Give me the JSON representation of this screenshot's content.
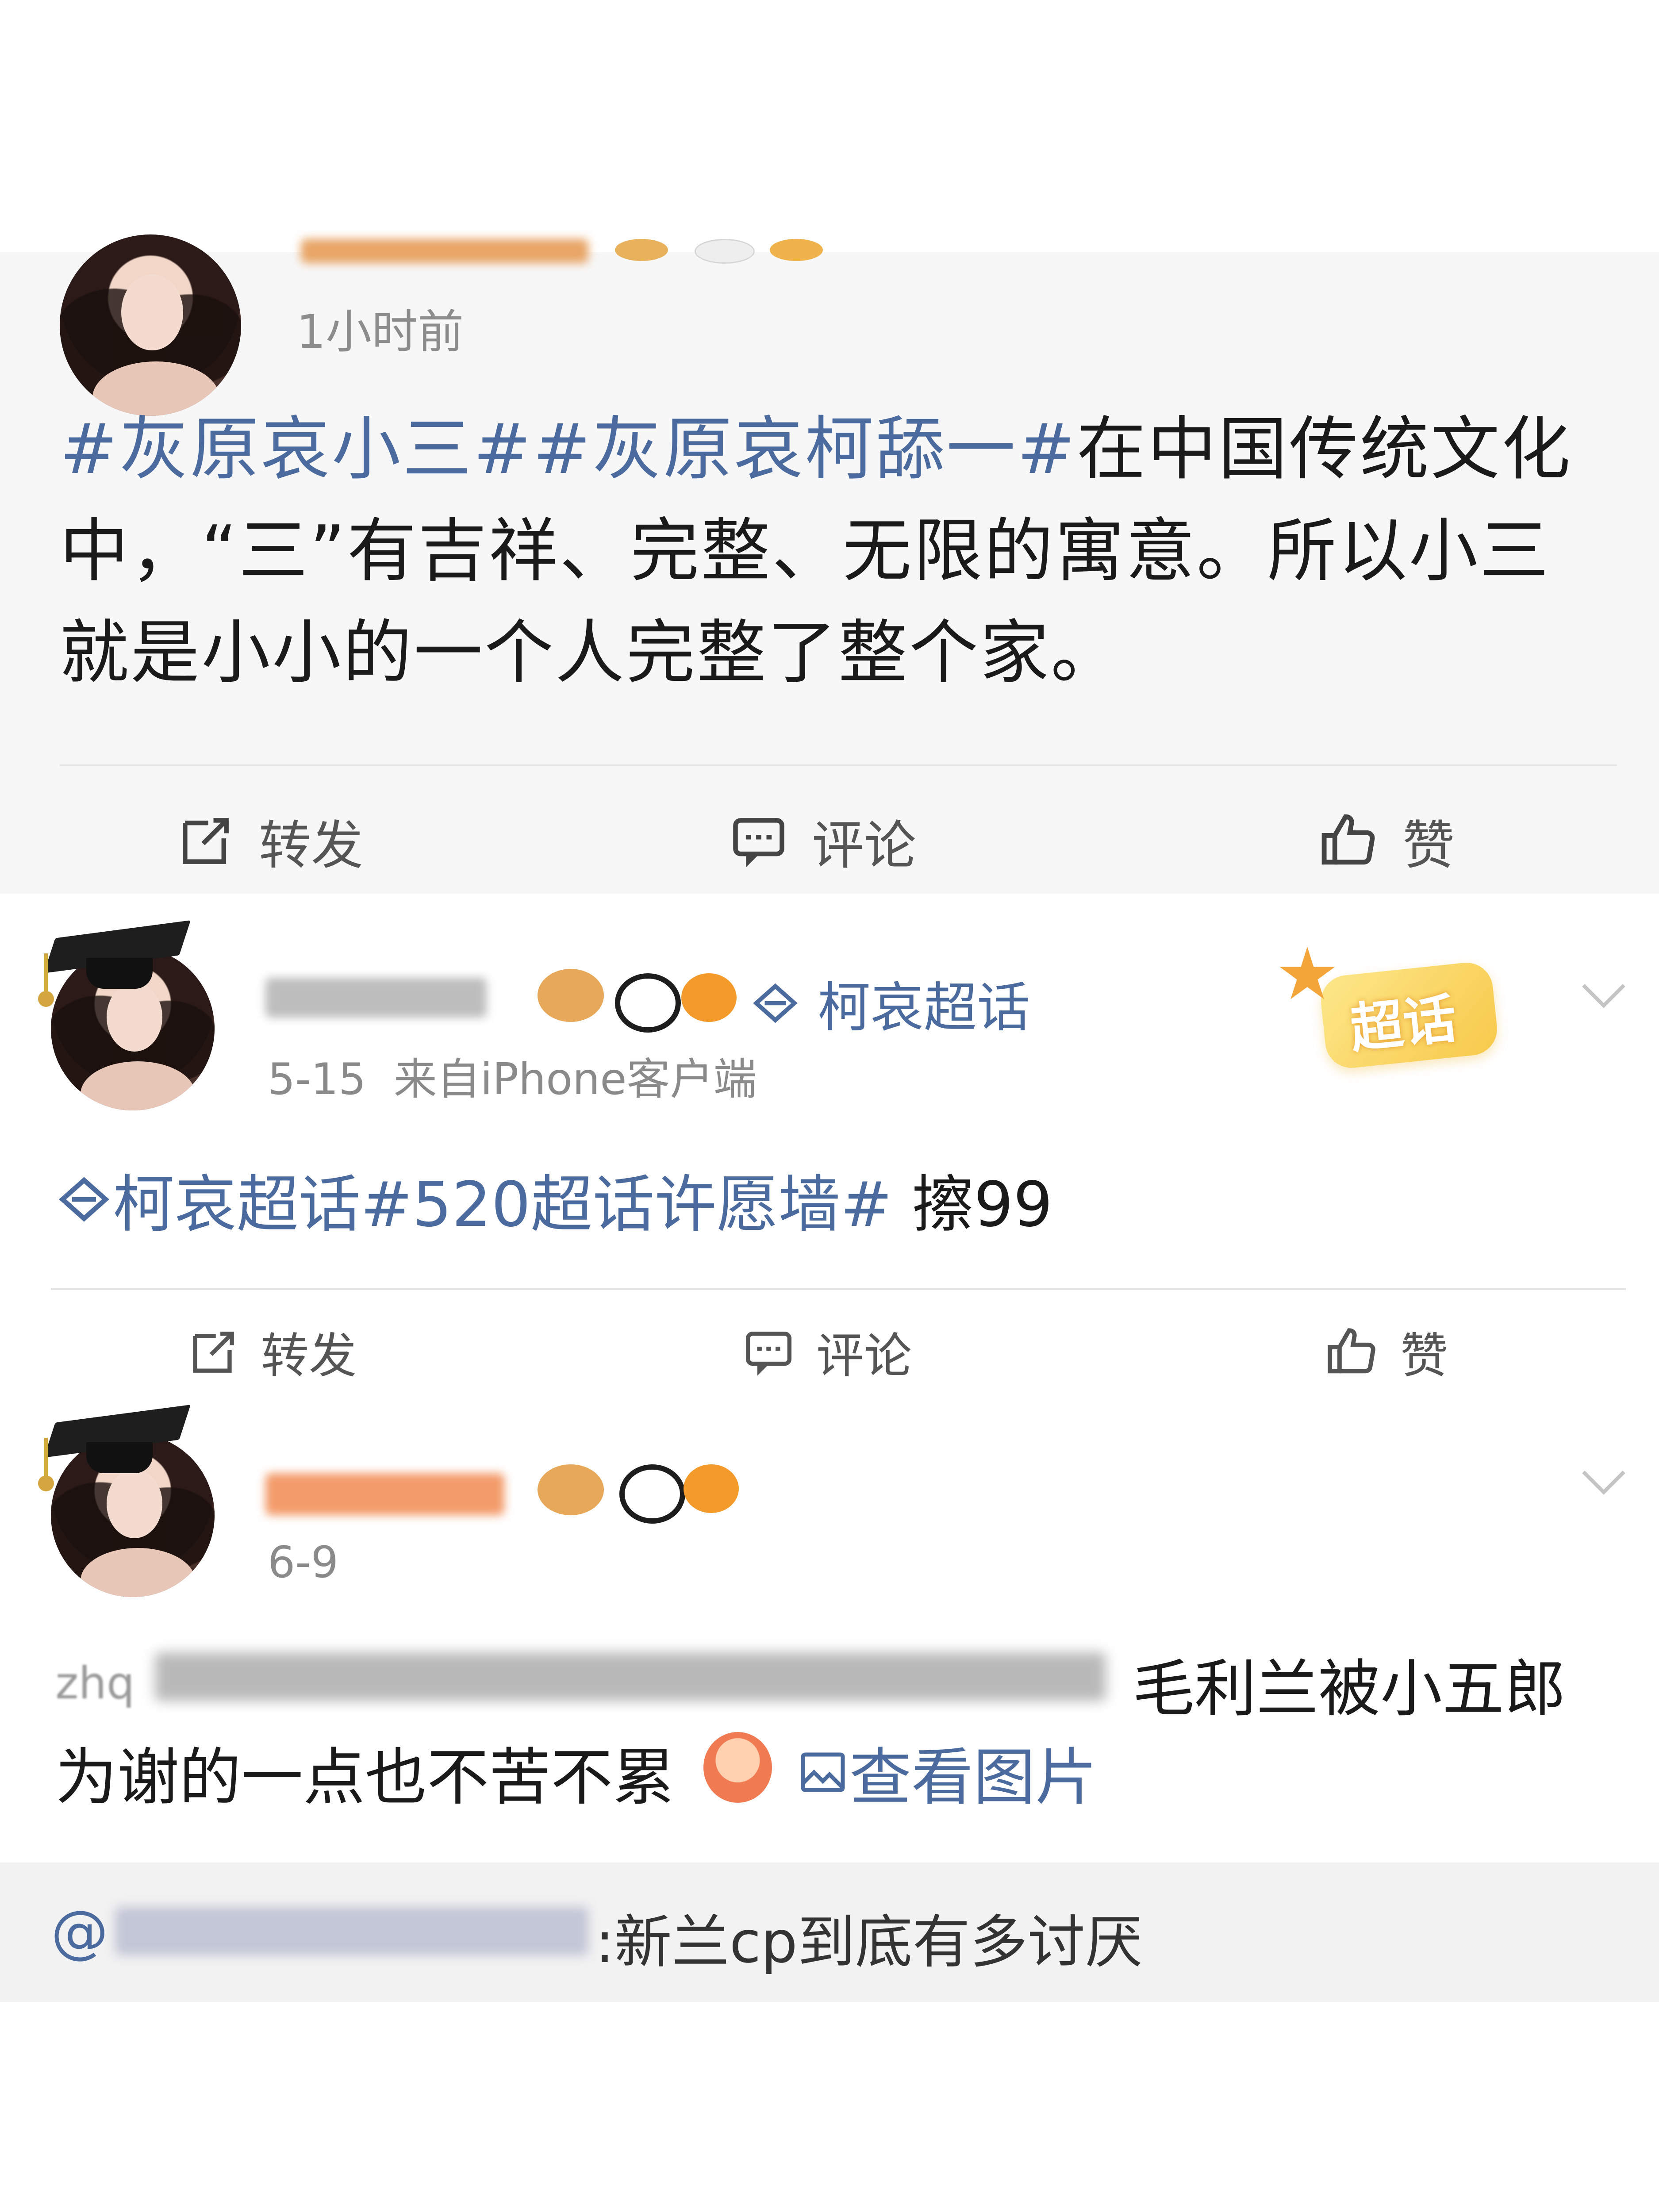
{
  "posts": [
    {
      "time": "1小时前",
      "text_link": "#灰原哀小三##灰原哀柯舔一#",
      "text_line1_rest": "在中国传统文化",
      "text_line2": "中，“三”有吉祥、完整、无限的寓意。所以小三",
      "text_line3": "就是小小的一个人完整了整个家。",
      "actions": {
        "repost": "转发",
        "comment": "评论",
        "like": "赞"
      }
    },
    {
      "topic_link": "柯哀超话",
      "meta": "5-15  来自iPhone客户端",
      "badge": "超话",
      "text_link": "柯哀超话#520超话许愿墙#",
      "text_rest": " 擦99",
      "actions": {
        "repost": "转发",
        "comment": "评论",
        "like": "赞"
      }
    },
    {
      "meta": "6-9",
      "text_line1_prefix": "zhq",
      "text_line1_rest": "毛利兰被小五郎",
      "text_line2": "为谢的一点也不苦不累",
      "view_image": "查看图片",
      "quote_prefix": "@",
      "quote_text": ":新兰cp到底有多讨厌"
    }
  ],
  "icons": {
    "repost": "edit-square-icon",
    "comment": "comment-bubble-icon",
    "like": "thumbs-up-icon",
    "topic": "diamond-topic-icon",
    "image": "image-icon",
    "more": "chevron-down-icon"
  },
  "colors": {
    "link": "#4b6a9e",
    "text": "#1a1a1a",
    "meta": "#8a8a8a",
    "card_gray": "#f7f7f7"
  }
}
